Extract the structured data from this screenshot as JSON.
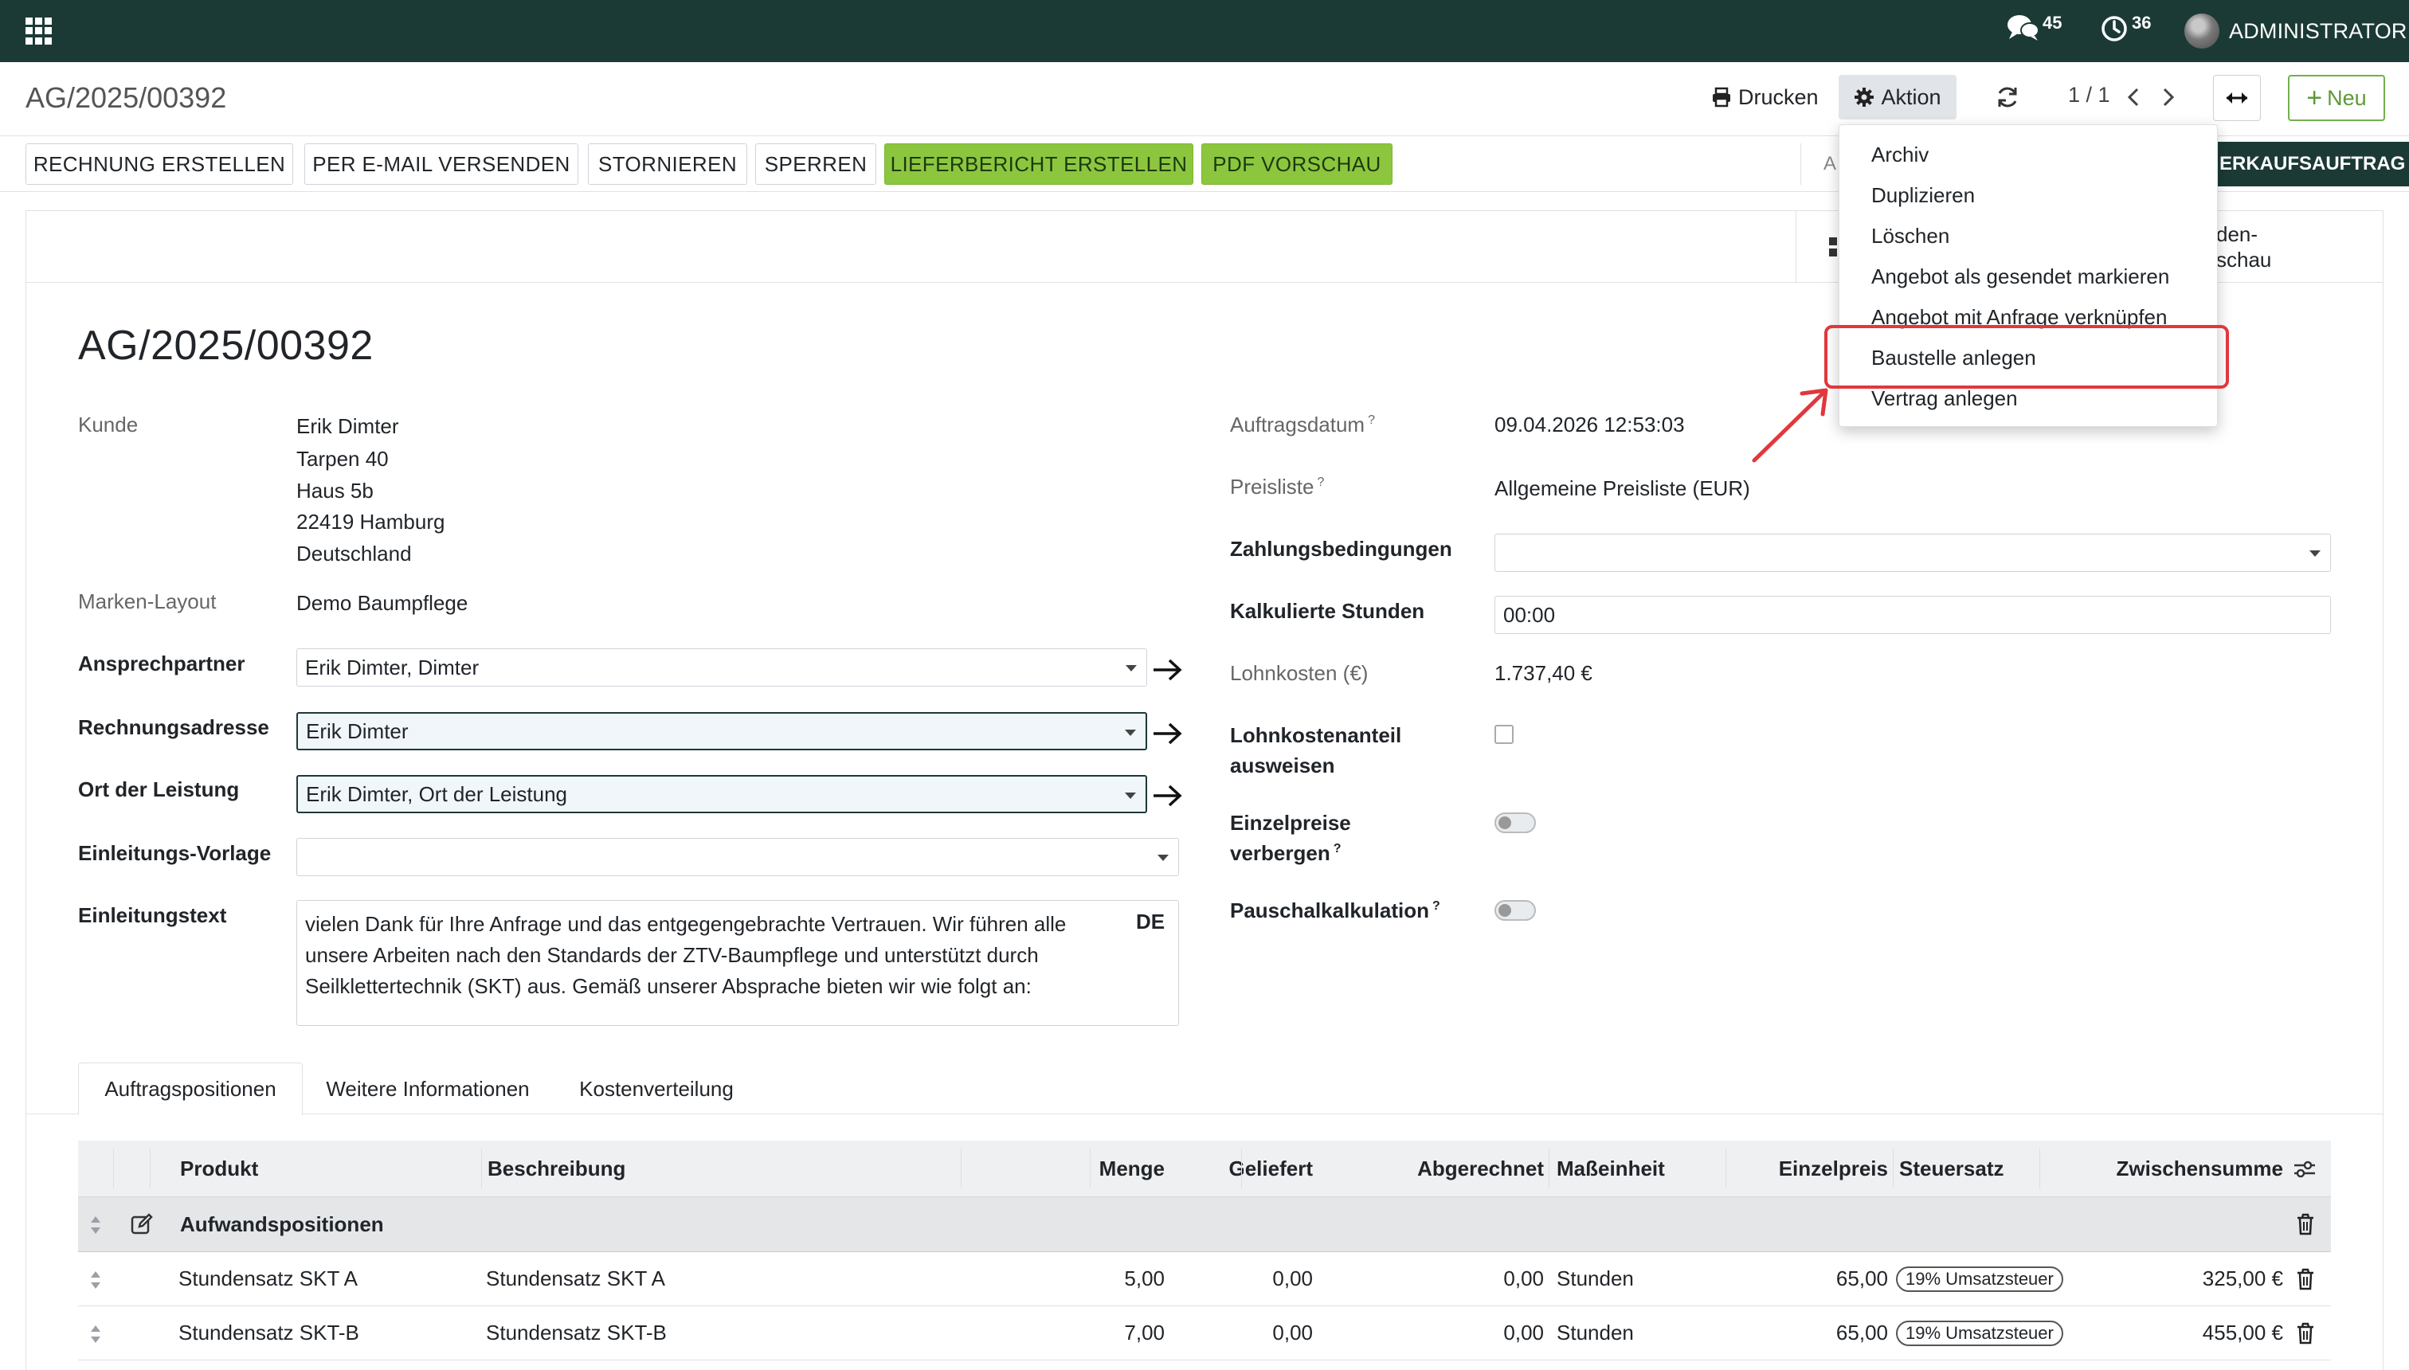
{
  "navbar": {
    "chat_count": "45",
    "activity_count": "36",
    "user_name": "ADMINISTRATOR"
  },
  "control_panel": {
    "record_title": "AG/2025/00392",
    "print_label": "Drucken",
    "action_label": "Aktion",
    "pager": "1 / 1",
    "new_label": "Neu"
  },
  "statusbar": {
    "buttons": [
      "RECHNUNG ERSTELLEN",
      "PER E-MAIL VERSENDEN",
      "STORNIEREN",
      "SPERREN",
      "LIEFERBERICHT ERSTELLEN",
      "PDF VORSCHAU"
    ],
    "state_partial": "A",
    "state_current": "ERKAUFSAUFTRAG"
  },
  "smart_button": {
    "label": "den-\nschau"
  },
  "form": {
    "name": "AG/2025/00392",
    "customer_label": "Kunde",
    "customer_lines": [
      "Erik Dimter",
      "Tarpen 40",
      "Haus 5b",
      "22419 Hamburg",
      "Deutschland"
    ],
    "brand_layout_label": "Marken-Layout",
    "brand_layout_value": "Demo Baumpflege",
    "contact_label": "Ansprechpartner",
    "contact_value": "Erik Dimter, Dimter",
    "invoice_address_label": "Rechnungsadresse",
    "invoice_address_value": "Erik Dimter",
    "service_location_label": "Ort der Leistung",
    "service_location_value": "Erik Dimter, Ort der Leistung",
    "intro_template_label": "Einleitungs-Vorlage",
    "intro_template_value": "",
    "intro_text_label": "Einleitungstext",
    "intro_text_value": "vielen Dank für Ihre Anfrage und das entgegengebrachte Vertrauen. Wir führen alle unsere Arbeiten nach den Standards der ZTV-Baumpflege und unterstützt durch Seilklettertechnik (SKT) aus. Gemäß unserer Absprache bieten wir wie folgt an:",
    "intro_text_lang": "DE",
    "order_date_label": "Auftragsdatum",
    "order_date_value": "09.04.2026 12:53:03",
    "pricelist_label": "Preisliste",
    "pricelist_value": "Allgemeine Preisliste (EUR)",
    "payment_terms_label": "Zahlungsbedingungen",
    "payment_terms_value": "",
    "calc_hours_label": "Kalkulierte Stunden",
    "calc_hours_value": "00:00",
    "labor_cost_label": "Lohnkosten (€)",
    "labor_cost_value": "1.737,40 €",
    "show_labor_share_label_1": "Lohnkostenanteil",
    "show_labor_share_label_2": "ausweisen",
    "show_labor_share_checked": false,
    "hide_unit_prices_label_1": "Einzelpreise",
    "hide_unit_prices_label_2": "verbergen",
    "hide_unit_prices_on": false,
    "flat_rate_label": "Pauschalkalkulation",
    "flat_rate_on": false,
    "help_mark": "?"
  },
  "tabs": [
    "Auftragspositionen",
    "Weitere Informationen",
    "Kostenverteilung"
  ],
  "lines_table": {
    "headers": {
      "product": "Produkt",
      "description": "Beschreibung",
      "qty": "Menge",
      "delivered": "Geliefert",
      "invoiced": "Abgerechnet",
      "uom": "Maßeinheit",
      "unit_price": "Einzelpreis",
      "tax": "Steuersatz",
      "subtotal": "Zwischensumme"
    },
    "section": "Aufwandspositionen",
    "rows": [
      {
        "product": "Stundensatz SKT A",
        "description": "Stundensatz SKT A",
        "qty": "5,00",
        "delivered": "0,00",
        "invoiced": "0,00",
        "uom": "Stunden",
        "unit_price": "65,00",
        "tax": "19% Umsatzsteuer",
        "subtotal": "325,00 €"
      },
      {
        "product": "Stundensatz SKT-B",
        "description": "Stundensatz SKT-B",
        "qty": "7,00",
        "delivered": "0,00",
        "invoiced": "0,00",
        "uom": "Stunden",
        "unit_price": "65,00",
        "tax": "19% Umsatzsteuer",
        "subtotal": "455,00 €"
      }
    ]
  },
  "action_menu": {
    "items": [
      "Archiv",
      "Duplizieren",
      "Löschen",
      "Angebot als gesendet markieren",
      "Angebot mit Anfrage verknüpfen",
      "Baustelle anlegen",
      "Vertrag anlegen"
    ],
    "highlighted": "Baustelle anlegen"
  },
  "colors": {
    "navbar": "#1c3a35",
    "primary_button": "#8cc63f",
    "new_button": "#71b04a",
    "highlight": "#e0383d"
  }
}
